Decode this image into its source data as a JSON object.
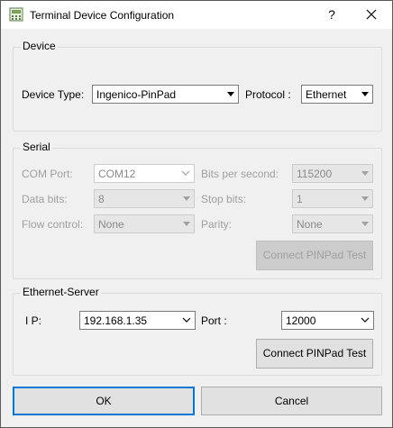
{
  "window": {
    "title": "Terminal Device Configuration",
    "help_label": "?"
  },
  "device": {
    "group_label": "Device",
    "device_type_label": "Device Type:",
    "device_type_value": "Ingenico-PinPad",
    "protocol_label": "Protocol :",
    "protocol_value": "Ethernet"
  },
  "serial": {
    "group_label": "Serial",
    "com_port_label": "COM Port:",
    "com_port_value": "COM12",
    "bits_label": "Bits per second:",
    "bits_value": "115200",
    "data_bits_label": "Data bits:",
    "data_bits_value": "8",
    "stop_bits_label": "Stop bits:",
    "stop_bits_value": "1",
    "flow_label": "Flow control:",
    "flow_value": "None",
    "parity_label": "Parity:",
    "parity_value": "None",
    "test_button": "Connect PINPad Test"
  },
  "ethernet": {
    "group_label": "Ethernet-Server",
    "ip_label": "I P:",
    "ip_value": "192.168.1.35",
    "port_label": "Port :",
    "port_value": "12000",
    "test_button": "Connect PINPad Test"
  },
  "footer": {
    "ok_label": "OK",
    "cancel_label": "Cancel"
  },
  "colors": {
    "focus": "#0078d7",
    "disabled_text": "#a0a0a0",
    "background": "#f0f0f0"
  }
}
